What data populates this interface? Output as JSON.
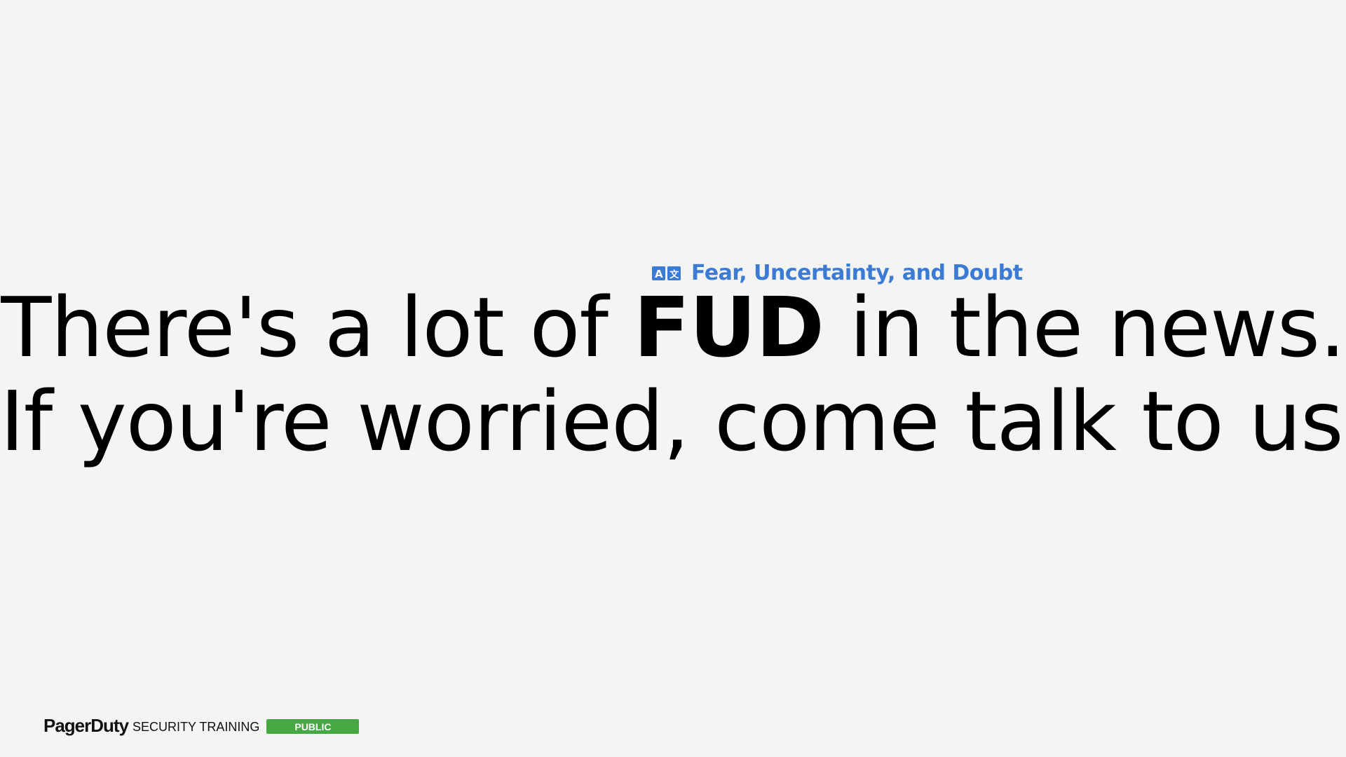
{
  "headline": {
    "line1_before": "There's a lot of ",
    "line1_emphasis": "FUD",
    "line1_after": " in the news.",
    "line2": "If you're worried, come talk to us!"
  },
  "annotation": {
    "icon": "translate-icon",
    "text": "Fear, Uncertainty, and Doubt"
  },
  "footer": {
    "logo": "PagerDuty",
    "subtitle": "SECURITY TRAINING",
    "badge": "PUBLIC"
  },
  "colors": {
    "background": "#f4f4f4",
    "text": "#000000",
    "annotation": "#3b7bd4",
    "badge": "#45a843"
  }
}
